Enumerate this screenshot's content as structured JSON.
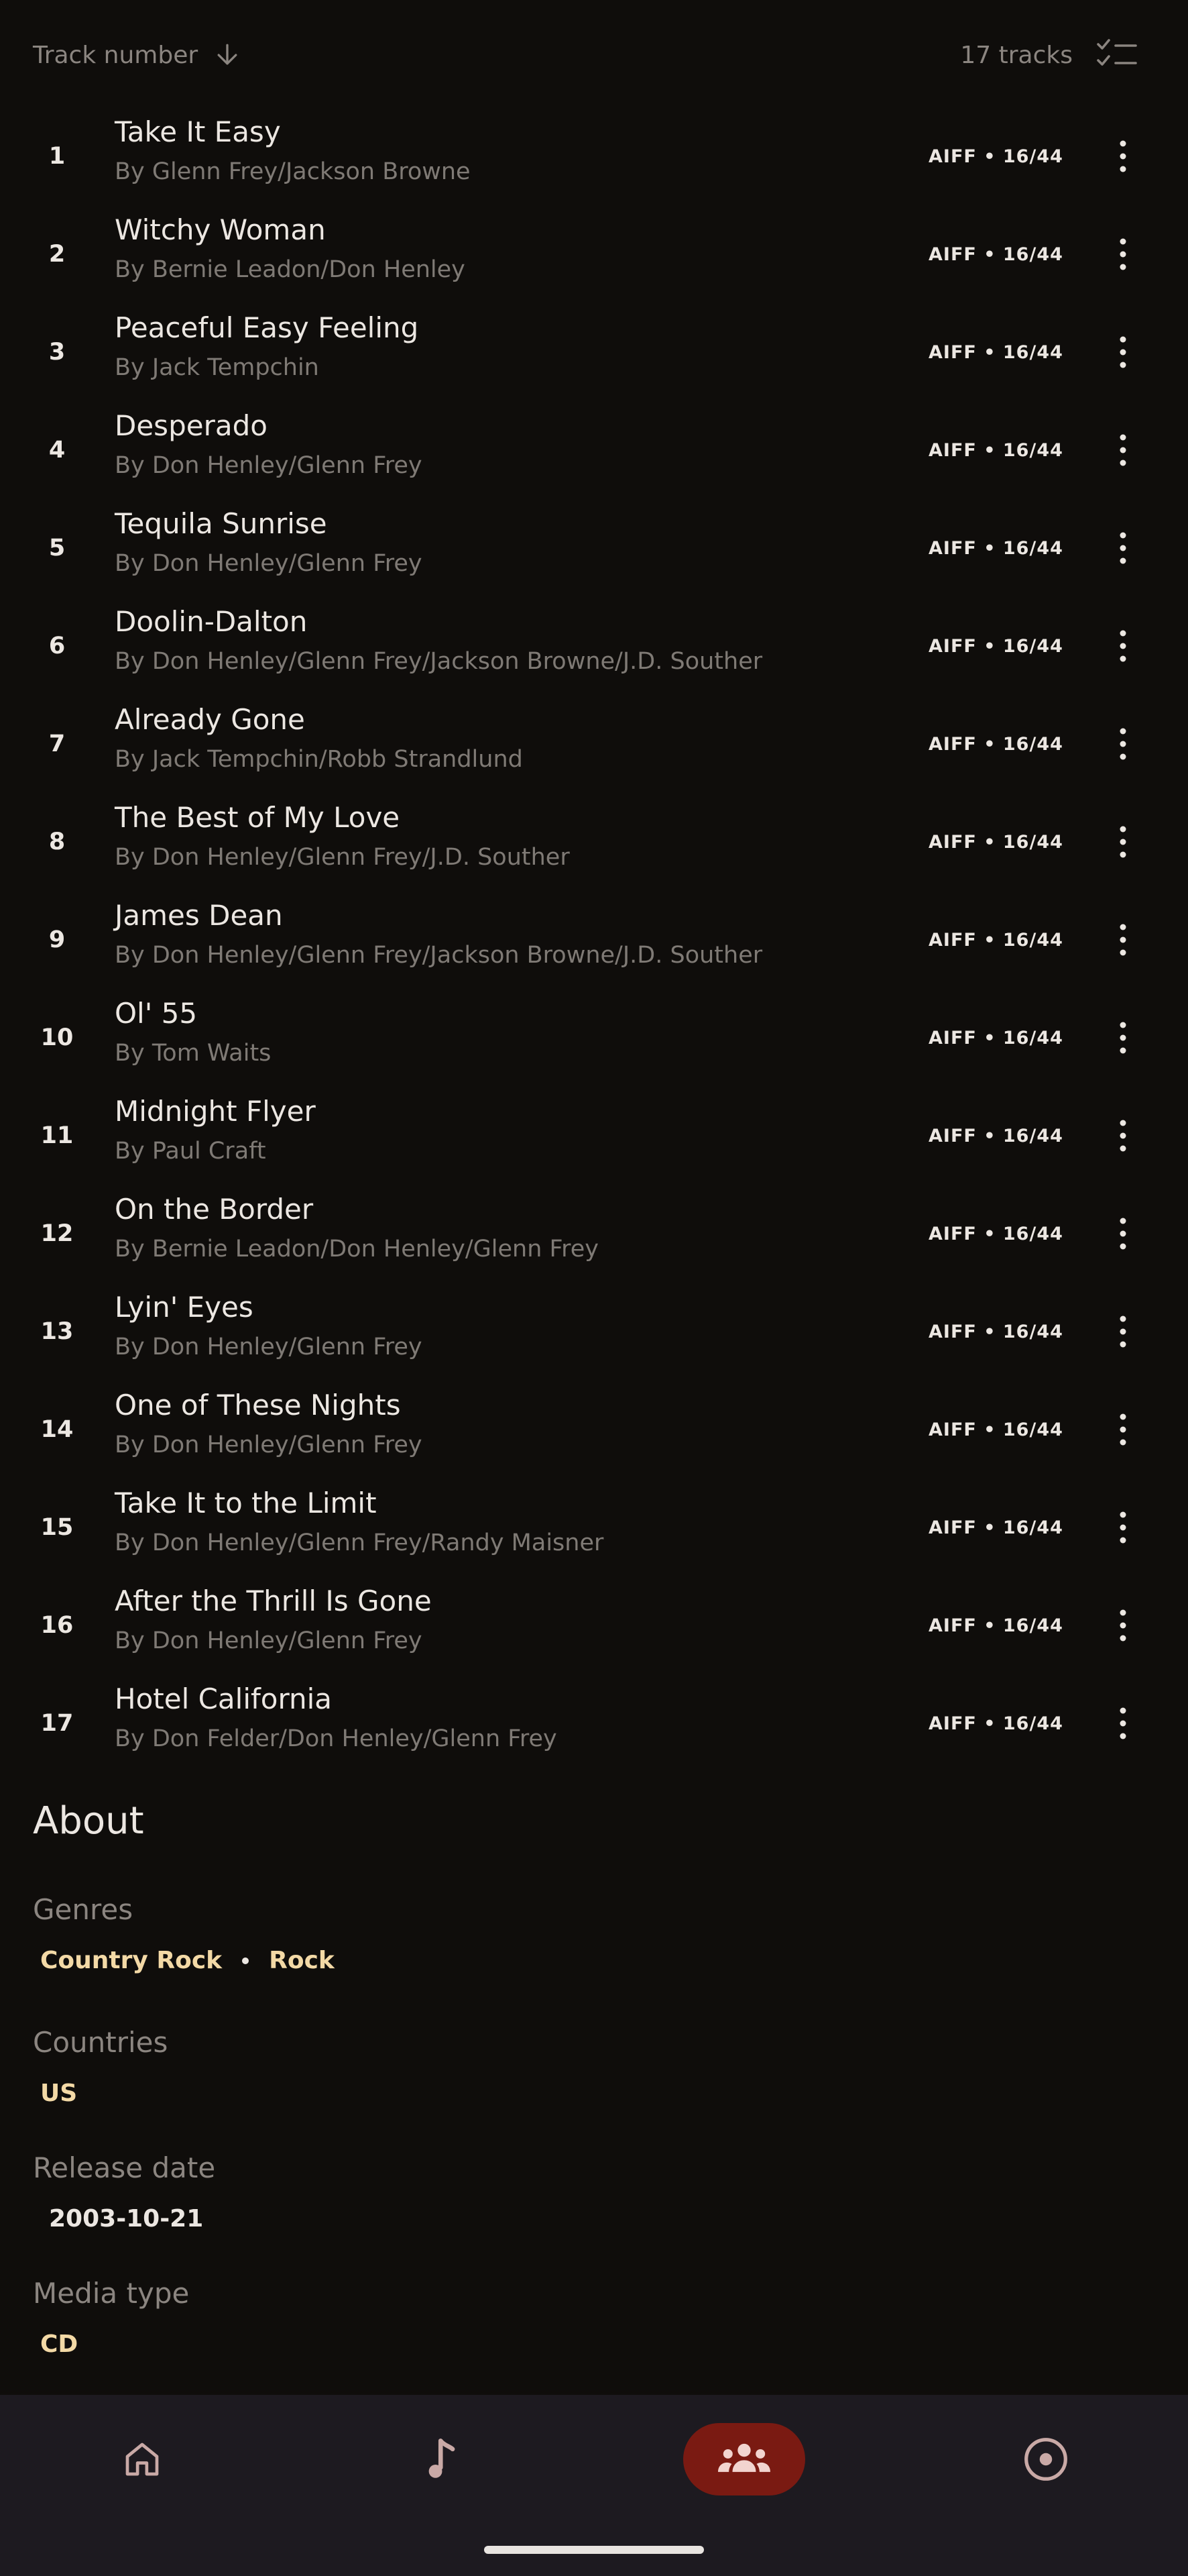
{
  "header": {
    "sort_label": "Track number",
    "sort_icon": "arrow-down-icon",
    "track_count": "17 tracks",
    "select_icon": "checklist-icon"
  },
  "tracks": [
    {
      "num": "1",
      "title": "Take It Easy",
      "artist": "By Glenn Frey/Jackson Browne",
      "format": "AIFF • 16/44"
    },
    {
      "num": "2",
      "title": "Witchy Woman",
      "artist": "By Bernie Leadon/Don Henley",
      "format": "AIFF • 16/44"
    },
    {
      "num": "3",
      "title": "Peaceful Easy Feeling",
      "artist": "By Jack Tempchin",
      "format": "AIFF • 16/44"
    },
    {
      "num": "4",
      "title": "Desperado",
      "artist": "By Don Henley/Glenn Frey",
      "format": "AIFF • 16/44"
    },
    {
      "num": "5",
      "title": "Tequila Sunrise",
      "artist": "By Don Henley/Glenn Frey",
      "format": "AIFF • 16/44"
    },
    {
      "num": "6",
      "title": "Doolin-Dalton",
      "artist": "By Don Henley/Glenn Frey/Jackson Browne/J.D. Souther",
      "format": "AIFF • 16/44"
    },
    {
      "num": "7",
      "title": "Already Gone",
      "artist": "By Jack Tempchin/Robb Strandlund",
      "format": "AIFF • 16/44"
    },
    {
      "num": "8",
      "title": "The Best of My Love",
      "artist": "By Don Henley/Glenn Frey/J.D. Souther",
      "format": "AIFF • 16/44"
    },
    {
      "num": "9",
      "title": "James Dean",
      "artist": "By Don Henley/Glenn Frey/Jackson Browne/J.D. Souther",
      "format": "AIFF • 16/44"
    },
    {
      "num": "10",
      "title": "Ol' 55",
      "artist": "By Tom Waits",
      "format": "AIFF • 16/44"
    },
    {
      "num": "11",
      "title": "Midnight Flyer",
      "artist": "By Paul Craft",
      "format": "AIFF • 16/44"
    },
    {
      "num": "12",
      "title": "On the Border",
      "artist": "By Bernie Leadon/Don Henley/Glenn Frey",
      "format": "AIFF • 16/44"
    },
    {
      "num": "13",
      "title": "Lyin' Eyes",
      "artist": "By Don Henley/Glenn Frey",
      "format": "AIFF • 16/44"
    },
    {
      "num": "14",
      "title": "One of These Nights",
      "artist": "By Don Henley/Glenn Frey",
      "format": "AIFF • 16/44"
    },
    {
      "num": "15",
      "title": "Take It to the Limit",
      "artist": "By Don Henley/Glenn Frey/Randy Maisner",
      "format": "AIFF • 16/44"
    },
    {
      "num": "16",
      "title": "After the Thrill Is Gone",
      "artist": "By Don Henley/Glenn Frey",
      "format": "AIFF • 16/44"
    },
    {
      "num": "17",
      "title": "Hotel California",
      "artist": "By Don Felder/Don Henley/Glenn Frey",
      "format": "AIFF • 16/44"
    }
  ],
  "about": {
    "title": "About",
    "genres_label": "Genres",
    "genres": [
      "Country Rock",
      "Rock"
    ],
    "countries_label": "Countries",
    "countries": [
      "US"
    ],
    "release_label": "Release date",
    "release_date": "2003-10-21",
    "media_label": "Media type",
    "media": [
      "CD"
    ]
  },
  "nav": {
    "items": [
      {
        "id": "home",
        "icon": "home-icon"
      },
      {
        "id": "music",
        "icon": "music-note-icon"
      },
      {
        "id": "artists",
        "icon": "people-icon",
        "active": true
      },
      {
        "id": "albums",
        "icon": "disc-icon"
      }
    ]
  },
  "colors": {
    "background": "#0f0d0b",
    "accent_chip": "#f3d9a6",
    "nav_active": "#7a1a12",
    "nav_bar": "#1d1a20",
    "muted_text": "#7f7a75"
  }
}
